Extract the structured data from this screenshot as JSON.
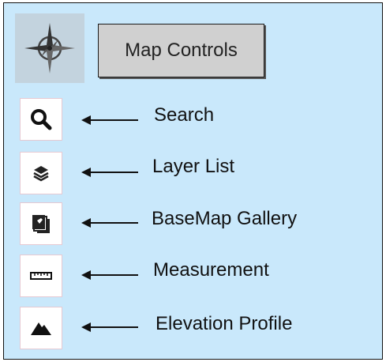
{
  "header": {
    "title": "Map Controls",
    "compass_icon": "compass-icon"
  },
  "tools": [
    {
      "icon": "search-icon",
      "label": "Search"
    },
    {
      "icon": "layers-icon",
      "label": "Layer List"
    },
    {
      "icon": "basemap-gallery-icon",
      "label": "BaseMap Gallery"
    },
    {
      "icon": "ruler-icon",
      "label": "Measurement"
    },
    {
      "icon": "mountain-icon",
      "label": "Elevation Profile"
    }
  ],
  "colors": {
    "panel_background": "#c9e8fb",
    "compass_background": "#c3d3de",
    "title_button_background": "#d0d0d0",
    "tool_border": "#e6c9d2"
  }
}
